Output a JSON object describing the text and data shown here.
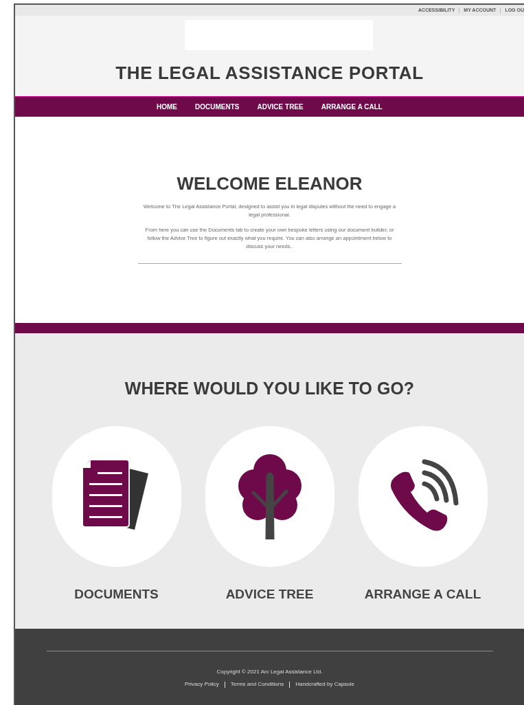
{
  "utility_links": [
    "ACCESSIBILITY",
    "MY ACCOUNT",
    "LOG OU"
  ],
  "site_title": "THE LEGAL ASSISTANCE PORTAL",
  "nav": [
    {
      "label": "HOME"
    },
    {
      "label": "DOCUMENTS"
    },
    {
      "label": "ADVICE TREE"
    },
    {
      "label": "ARRANGE A CALL"
    }
  ],
  "welcome": {
    "heading": "WELCOME ELEANOR",
    "paragraphs": [
      "Welcome to The Legal Assistance Portal, designed to assist you in legal disputes without the need to engage a legal professional.",
      "From here you can use the Documents tab to create your own bespoke letters using our document builder, or follow the Advice Tree to figure out exactly what you require. You can also arrange an appointment below to discuss your needs.."
    ]
  },
  "destinations": {
    "heading": "WHERE WOULD YOU LIKE TO GO?",
    "items": [
      {
        "kind": "documents",
        "label": "DOCUMENTS"
      },
      {
        "kind": "tree",
        "label": "ADVICE TREE"
      },
      {
        "kind": "phone",
        "label": "ARRANGE A CALL"
      }
    ]
  },
  "footer": {
    "copyright": "Copyright © 2021 Arc Legal Assistance Ltd.",
    "links": [
      "Privacy Policy",
      "Terms and Conditions",
      "Handcrafted by Capsule"
    ]
  }
}
